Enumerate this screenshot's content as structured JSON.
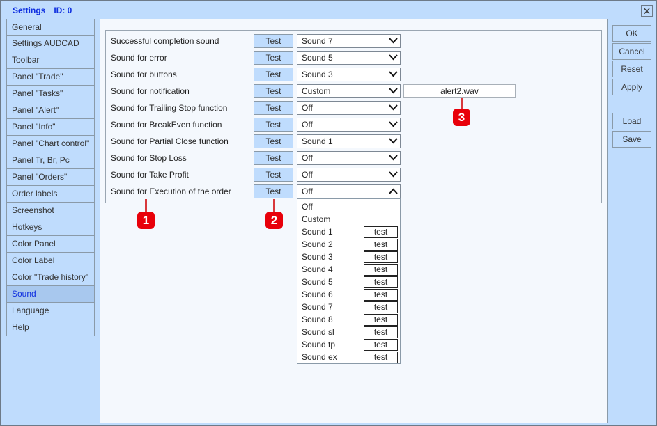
{
  "window": {
    "title": "Settings",
    "id_label": "ID: 0",
    "close_icon": "close-icon"
  },
  "sidebar": {
    "items": [
      "General",
      "Settings AUDCAD",
      "Toolbar",
      "Panel \"Trade\"",
      "Panel \"Tasks\"",
      "Panel \"Alert\"",
      "Panel \"Info\"",
      "Panel \"Chart control\"",
      "Panel Tr, Br, Pc",
      "Panel \"Orders\"",
      "Order labels",
      "Screenshot",
      "Hotkeys",
      "Color Panel",
      "Color Label",
      "Color \"Trade history\"",
      "Sound",
      "Language",
      "Help"
    ],
    "selected": "Sound"
  },
  "rows": [
    {
      "label": "Successful completion sound",
      "test": "Test",
      "value": "Sound 7"
    },
    {
      "label": "Sound for error",
      "test": "Test",
      "value": "Sound 5"
    },
    {
      "label": "Sound for buttons",
      "test": "Test",
      "value": "Sound 3"
    },
    {
      "label": "Sound for notification",
      "test": "Test",
      "value": "Custom"
    },
    {
      "label": "Sound for Trailing Stop function",
      "test": "Test",
      "value": "Off"
    },
    {
      "label": "Sound for BreakEven function",
      "test": "Test",
      "value": "Off"
    },
    {
      "label": "Sound for Partial Close function",
      "test": "Test",
      "value": "Sound 1"
    },
    {
      "label": "Sound for Stop Loss",
      "test": "Test",
      "value": "Off"
    },
    {
      "label": "Sound for Take Profit",
      "test": "Test",
      "value": "Off"
    },
    {
      "label": "Sound for Execution of the order",
      "test": "Test",
      "value": "Off"
    }
  ],
  "custom_file": "alert2.wav",
  "dropdown_options": [
    {
      "label": "Off"
    },
    {
      "label": "Custom"
    },
    {
      "label": "Sound 1",
      "test": "test"
    },
    {
      "label": "Sound 2",
      "test": "test"
    },
    {
      "label": "Sound 3",
      "test": "test"
    },
    {
      "label": "Sound 4",
      "test": "test"
    },
    {
      "label": "Sound 5",
      "test": "test"
    },
    {
      "label": "Sound 6",
      "test": "test"
    },
    {
      "label": "Sound 7",
      "test": "test"
    },
    {
      "label": "Sound 8",
      "test": "test"
    },
    {
      "label": "Sound sl",
      "test": "test"
    },
    {
      "label": "Sound tp",
      "test": "test"
    },
    {
      "label": "Sound ex",
      "test": "test"
    }
  ],
  "buttons": {
    "ok": "OK",
    "cancel": "Cancel",
    "reset": "Reset",
    "apply": "Apply",
    "load": "Load",
    "save": "Save"
  },
  "markers": [
    "1",
    "2",
    "3"
  ],
  "colors": {
    "window_bg": "#bfdcfd",
    "title": "#1030e0",
    "marker": "#e8000a"
  }
}
